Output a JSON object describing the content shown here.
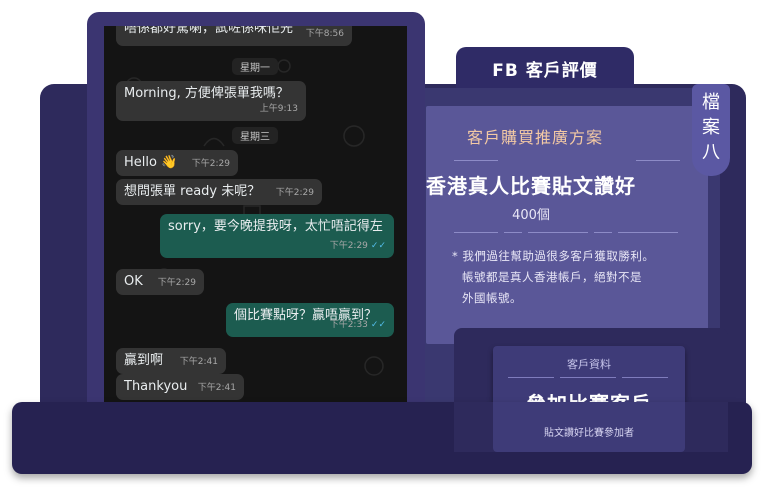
{
  "chat": {
    "partial_text": "唔係都好驚喇，試咗係咪佢先",
    "partial_time": "下午8:56",
    "day1": "星期一",
    "msg_morning": "Morning, 方便俾張單我嗎？",
    "time_morning": "上午9:13",
    "day2": "星期三",
    "msg_hello": "Hello 👋",
    "time_hello": "下午2:29",
    "msg_ready": "想問張單 ready 未呢？",
    "time_ready": "下午2:29",
    "msg_sorry": "sorry，要今晚提我呀，太忙唔記得左",
    "time_sorry": "下午2:29",
    "msg_ok": "OK",
    "time_ok": "下午2:29",
    "msg_point": "個比賽點呀？贏唔贏到？",
    "time_point": "下午2:33",
    "msg_win": "贏到啊",
    "time_win": "下午2:41",
    "msg_thanks": "Thankyou",
    "time_thanks": "下午2:41"
  },
  "tab": {
    "title": "FB 客戶評價"
  },
  "side_label": {
    "lines": [
      "檔",
      "案",
      "八"
    ]
  },
  "card": {
    "title": "客戶購買推廣方案",
    "headline": "香港真人比賽貼文讚好",
    "quantity": "400個",
    "note_line1": "* 我們過往幫助過很多客戶獲取勝利。",
    "note_line2": "帳號都是真人香港帳戶，絕對不是",
    "note_line3": "外國帳號。"
  },
  "client": {
    "label": "客戶資料",
    "title": "參加比賽客戶",
    "subtitle": "貼文讚好比賽參加者"
  },
  "colors": {
    "accent": "#f3c9a4",
    "outgoing": "#1c5c50",
    "incoming": "#343434",
    "panel": "#5a5798"
  }
}
